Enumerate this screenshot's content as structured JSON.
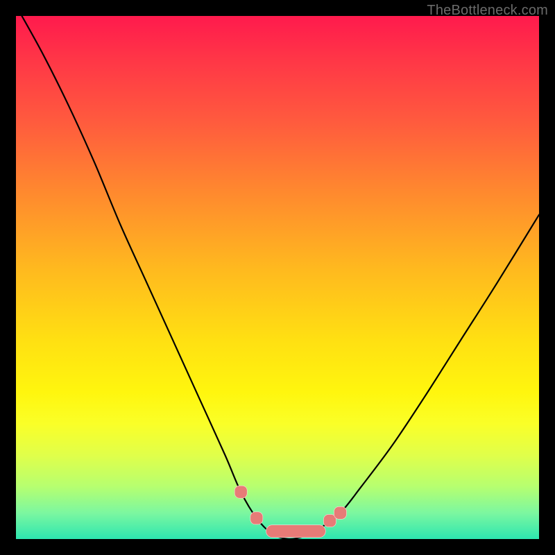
{
  "watermark": "TheBottleneck.com",
  "colors": {
    "background": "#000000",
    "curve": "#000000",
    "marker_fill": "#e77b77",
    "marker_stroke": "#ffd9d9"
  },
  "chart_data": {
    "type": "line",
    "title": "",
    "xlabel": "",
    "ylabel": "",
    "xlim": [
      0,
      100
    ],
    "ylim": [
      0,
      100
    ],
    "grid": false,
    "series": [
      {
        "name": "bottleneck-curve",
        "x": [
          0,
          5,
          10,
          15,
          20,
          25,
          30,
          35,
          40,
          43,
          46,
          49,
          52,
          55,
          58,
          62,
          66,
          72,
          78,
          85,
          92,
          100
        ],
        "values": [
          102,
          93,
          83,
          72,
          60,
          49,
          38,
          27,
          16,
          9,
          4,
          1,
          0,
          0.5,
          2,
          5,
          10,
          18,
          27,
          38,
          49,
          62
        ]
      }
    ],
    "markers": {
      "name": "highlighted-points",
      "x": [
        43,
        46,
        49,
        52,
        55,
        58,
        60,
        62
      ],
      "values": [
        9,
        4,
        1,
        0,
        0.5,
        2,
        3.5,
        5
      ],
      "shape": "rounded-square"
    }
  }
}
